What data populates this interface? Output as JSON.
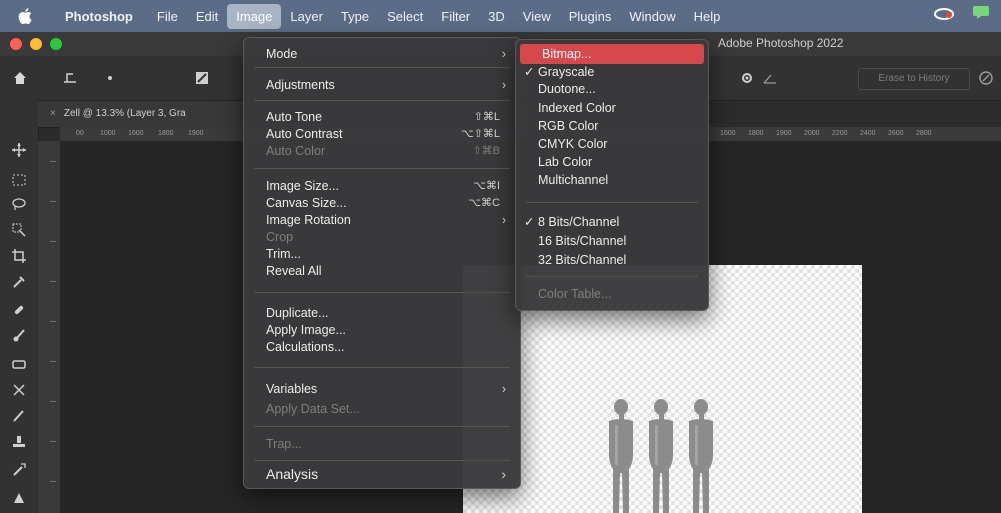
{
  "menubar": {
    "items": [
      "Photoshop",
      "File",
      "Edit",
      "Image",
      "Layer",
      "Type",
      "Select",
      "Filter",
      "3D",
      "View",
      "Plugins",
      "Window",
      "Help"
    ],
    "active_index": 3
  },
  "window": {
    "title": "Adobe Photoshop 2022"
  },
  "document_tab": {
    "label": "Zell @ 13.3% (Layer 3, Gra"
  },
  "options_bar": {
    "history_button": "Erase to History"
  },
  "ruler_marks": [
    "00",
    "1000",
    "1600",
    "1800",
    "1900",
    "1600",
    "1800",
    "1900",
    "2000",
    "2200",
    "2400",
    "2600",
    "2800"
  ],
  "image_menu": {
    "items": [
      {
        "label": "Mode",
        "submenu": true
      },
      {
        "label": "Adjustments",
        "submenu": true
      },
      {
        "label": "Auto Tone",
        "shortcut": "⇧⌘L"
      },
      {
        "label": "Auto Contrast",
        "shortcut": "⌥⇧⌘L"
      },
      {
        "label": "Auto Color",
        "shortcut": "⇧⌘B",
        "disabled": true
      },
      {
        "label": "Image Size...",
        "shortcut": "⌥⌘I"
      },
      {
        "label": "Canvas Size...",
        "shortcut": "⌥⌘C"
      },
      {
        "label": "Image Rotation",
        "submenu": true
      },
      {
        "label": "Crop",
        "disabled": true
      },
      {
        "label": "Trim..."
      },
      {
        "label": "Reveal All"
      },
      {
        "label": "Duplicate..."
      },
      {
        "label": "Apply Image..."
      },
      {
        "label": "Calculations..."
      },
      {
        "label": "Variables",
        "submenu": true
      },
      {
        "label": "Apply Data Set...",
        "disabled": true
      },
      {
        "label": "Trap...",
        "disabled": true
      },
      {
        "label": "Analysis",
        "submenu": true
      }
    ]
  },
  "mode_menu": {
    "items": [
      {
        "label": "Bitmap...",
        "highlighted": true
      },
      {
        "label": "Grayscale",
        "checked": true
      },
      {
        "label": "Duotone..."
      },
      {
        "label": "Indexed Color"
      },
      {
        "label": "RGB Color"
      },
      {
        "label": "CMYK Color"
      },
      {
        "label": "Lab Color"
      },
      {
        "label": "Multichannel"
      },
      {
        "label": "8 Bits/Channel",
        "checked": true
      },
      {
        "label": "16 Bits/Channel"
      },
      {
        "label": "32 Bits/Channel"
      },
      {
        "label": "Color Table...",
        "disabled": true
      }
    ]
  },
  "colors": {
    "menubar_bg": "#5b6d86",
    "highlight": "#d8474a",
    "traffic_red": "#ff5f57",
    "traffic_yellow": "#febc2e",
    "traffic_green": "#28c840"
  }
}
